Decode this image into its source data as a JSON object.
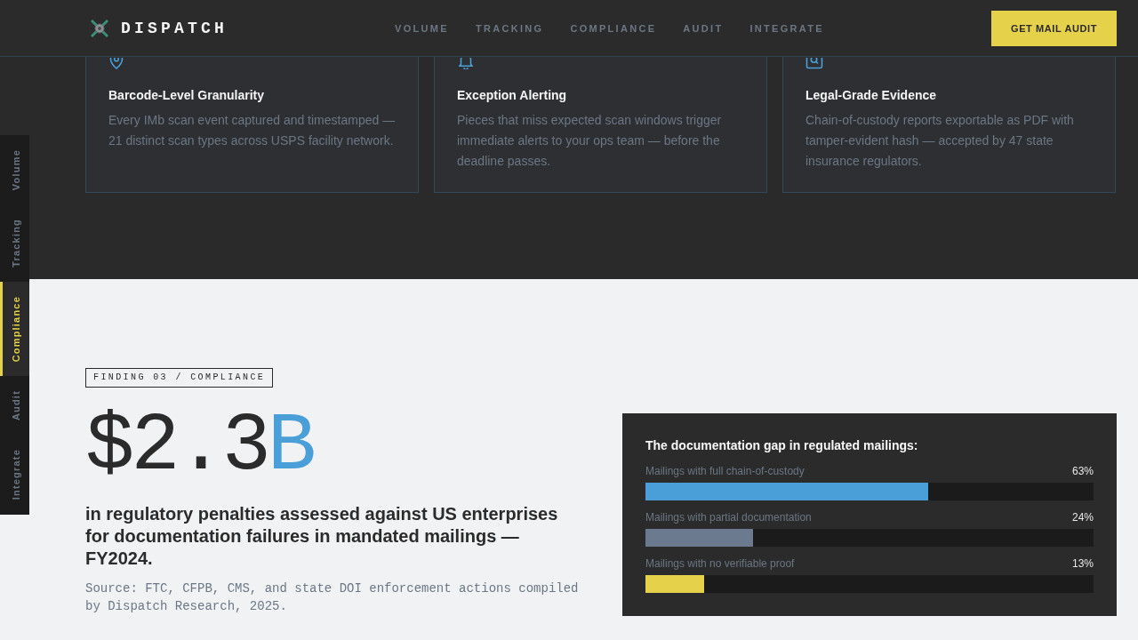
{
  "header": {
    "logo": "DISPATCH",
    "nav": [
      "VOLUME",
      "TRACKING",
      "COMPLIANCE",
      "AUDIT",
      "INTEGRATE"
    ],
    "cta": "GET MAIL AUDIT"
  },
  "side_nav": {
    "items": [
      {
        "label": "Volume",
        "selected": false
      },
      {
        "label": "Tracking",
        "selected": false
      },
      {
        "label": "Compliance",
        "selected": true
      },
      {
        "label": "Audit",
        "selected": false
      },
      {
        "label": "Integrate",
        "selected": false
      }
    ]
  },
  "features": [
    {
      "title": "Barcode-Level Granularity",
      "body": "Every IMb scan event captured and timestamped — 21 distinct scan types across USPS facility network."
    },
    {
      "title": "Exception Alerting",
      "body": "Pieces that miss expected scan windows trigger immediate alerts to your ops team — before the deadline passes."
    },
    {
      "title": "Legal-Grade Evidence",
      "body": "Chain-of-custody reports exportable as PDF with tamper-evident hash — accepted by 47 state insurance regulators."
    }
  ],
  "finding": {
    "tag": "FINDING 03 / COMPLIANCE",
    "figure": "$2.3",
    "figure_unit": "B",
    "headline": "in regulatory penalties assessed against US enterprises for documentation failures in mandated mailings — FY2024.",
    "source": "Source: FTC, CFPB, CMS, and state DOI enforcement actions compiled by Dispatch Research, 2025."
  },
  "gap_panel": {
    "title": "The documentation gap in regulated mailings:",
    "rows": [
      {
        "label": "Mailings with full chain-of-custody",
        "reading": "63%",
        "level": 0.63,
        "color": "#4a9fd8"
      },
      {
        "label": "Mailings with partial documentation",
        "reading": "24%",
        "level": 0.24,
        "color": "#6b7a8f"
      },
      {
        "label": "Mailings with no verifiable proof",
        "reading": "13%",
        "level": 0.13,
        "color": "#e6d14a"
      }
    ]
  }
}
